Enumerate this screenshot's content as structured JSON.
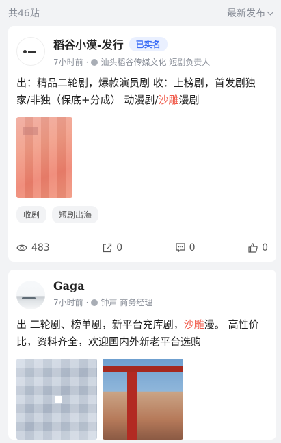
{
  "header": {
    "post_count": "共46贴",
    "sort_label": "最新发布"
  },
  "posts": [
    {
      "author": "稻谷小漠-发行",
      "verified_badge": "已实名",
      "time": "7小时前",
      "org": "汕头稻谷传媒文化 短剧负责人",
      "content_before": "出：精品二轮剧，爆款演员剧 收：上榜剧，首发剧独家/非独（保底+分成） 动漫剧/",
      "content_highlight": "沙雕",
      "content_after": "漫剧",
      "tags": [
        "收剧",
        "短剧出海"
      ],
      "stats": {
        "views": "483",
        "shares": "0",
        "comments": "0",
        "likes": "0"
      }
    },
    {
      "author": "Gaga",
      "time": "7小时前",
      "org": "钟声 商务经理",
      "content_before": "出 二轮剧、榜单剧，新平台充库剧，",
      "content_highlight": "沙雕",
      "content_after": "漫。 高性价比，资料齐全，欢迎国内外新老平台选购"
    }
  ],
  "colors": {
    "highlight": "#f05a4a",
    "badge": "#3a6cf6"
  },
  "icons": [
    "chevron-down-icon",
    "eye-icon",
    "share-icon",
    "comment-icon",
    "thumbs-up-icon"
  ]
}
